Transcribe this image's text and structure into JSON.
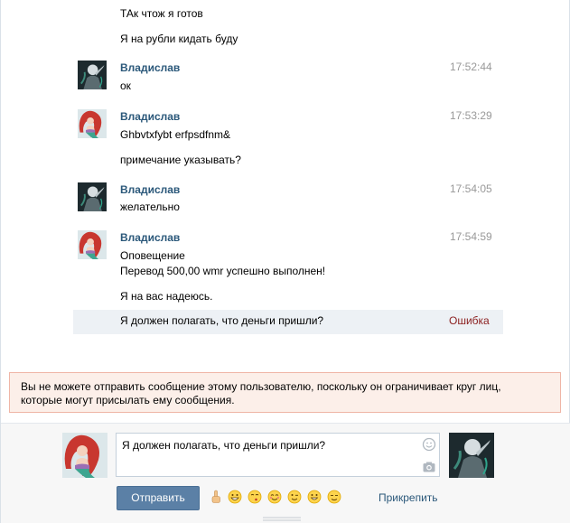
{
  "conversation": {
    "top_lines": [
      "ТАк чтож я готов",
      "Я на рубли кидать буду"
    ],
    "messages": [
      {
        "author": "Владислав",
        "time": "17:52:44",
        "avatar": "dark-avatar-icon",
        "lines": [
          "ок"
        ]
      },
      {
        "author": "Владислав",
        "time": "17:53:29",
        "avatar": "mermaid-avatar-icon",
        "lines": [
          "Ghbvtxfybt erfpsdfnm&",
          "примечание указывать?"
        ]
      },
      {
        "author": "Владислав",
        "time": "17:54:05",
        "avatar": "dark-avatar-icon",
        "lines": [
          "желательно"
        ]
      },
      {
        "author": "Владислав",
        "time": "17:54:59",
        "avatar": "mermaid-avatar-icon",
        "lines": [
          "Оповещение",
          "Перевод 500,00 wmr успешно выполнен!",
          "Я на вас надеюсь."
        ]
      }
    ],
    "failed_message": {
      "text": "Я должен полагать, что деньги пришли?",
      "status": "Ошибка"
    }
  },
  "warning": {
    "line1": "Вы не можете отправить сообщение этому пользователю, поскольку он ограничивает круг лиц,",
    "line2": "которые могут присылать ему сообщения."
  },
  "composer": {
    "input_value": "Я должен полагать, что деньги пришли?",
    "send_label": "Отправить",
    "attach_label": "Прикрепить",
    "emojis": [
      "pointing-finger-icon",
      "grin-icon",
      "whistle-icon",
      "blush-icon",
      "wink-icon",
      "smile-icon",
      "relieved-icon"
    ]
  },
  "colors": {
    "author": "#2b587a",
    "time": "#999999",
    "error": "#8b1e1e",
    "warning_bg": "#fcefe9",
    "warning_border": "#efb5a6",
    "send_button": "#5b80a6",
    "failed_row_bg": "#edf1f5"
  }
}
